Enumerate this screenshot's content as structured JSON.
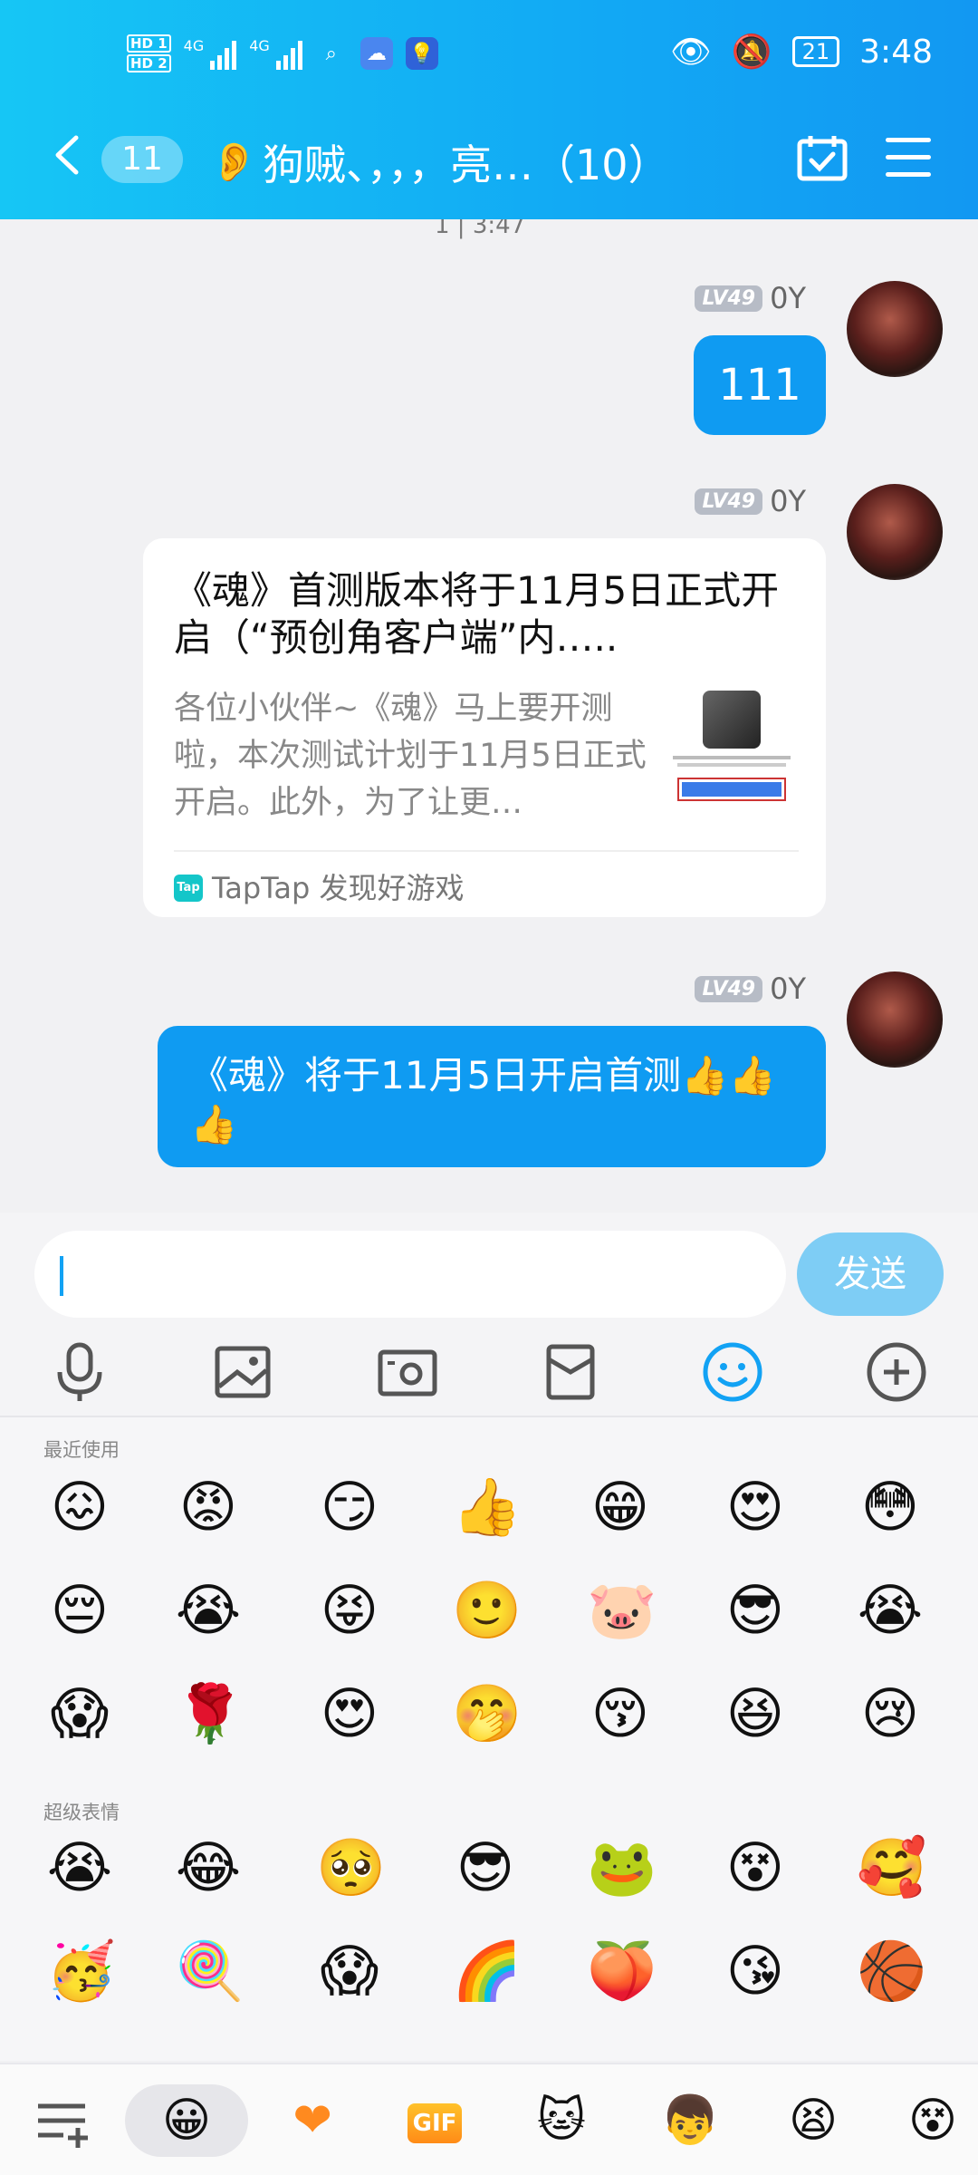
{
  "status_bar": {
    "hd1": "HD 1",
    "hd2": "HD 2",
    "net1": "4G",
    "net2": "4G",
    "battery": "21",
    "time": "3:48"
  },
  "header": {
    "unread_count": "11",
    "title": "狗贼、，，，亮…（10）"
  },
  "chat": {
    "cutoff_text": "1 | 3:47",
    "messages": [
      {
        "level": "LV49",
        "nick": "0Y",
        "text": "111"
      },
      {
        "level": "LV49",
        "nick": "0Y",
        "card_title": "《魂》首测版本将于11月5日正式开启（“预创角客户端”内…..",
        "card_desc": "各位小伙伴~《魂》马上要开测啦，本次测试计划于11月5日正式开启。此外，为了让更…",
        "card_source": "TapTap 发现好游戏"
      },
      {
        "level": "LV49",
        "nick": "0Y",
        "text": "《魂》将于11月5日开启首测👍👍👍"
      }
    ]
  },
  "input": {
    "placeholder": "",
    "send_label": "发送"
  },
  "emoji_panel": {
    "recent_label": "最近使用",
    "super_label": "超级表情",
    "recent": [
      "😖",
      "😡",
      "😏",
      "👍",
      "😁",
      "😍",
      "😳",
      "😔",
      "😭",
      "😝",
      "🙂",
      "🐷",
      "😎",
      "😭",
      "😱",
      "🌹",
      "😍",
      "🤭",
      "😚",
      "😆",
      "😢"
    ],
    "super": [
      "😭",
      "😂",
      "🥺",
      "😎",
      "🐸",
      "😵",
      "🥰",
      "🥳",
      "🍭",
      "😱",
      "🌈",
      "🍑",
      "😘",
      "🏀"
    ]
  },
  "tab_icons": [
    "list-add-icon",
    "emoji-icon",
    "heart-icon",
    "gif-icon",
    "cat-icon",
    "boy-icon",
    "rage-face-icon",
    "sticker-icon"
  ],
  "tab_gif_label": "GIF",
  "colors": {
    "accent": "#12a2f4",
    "send_disabled": "#7ecdf5"
  }
}
